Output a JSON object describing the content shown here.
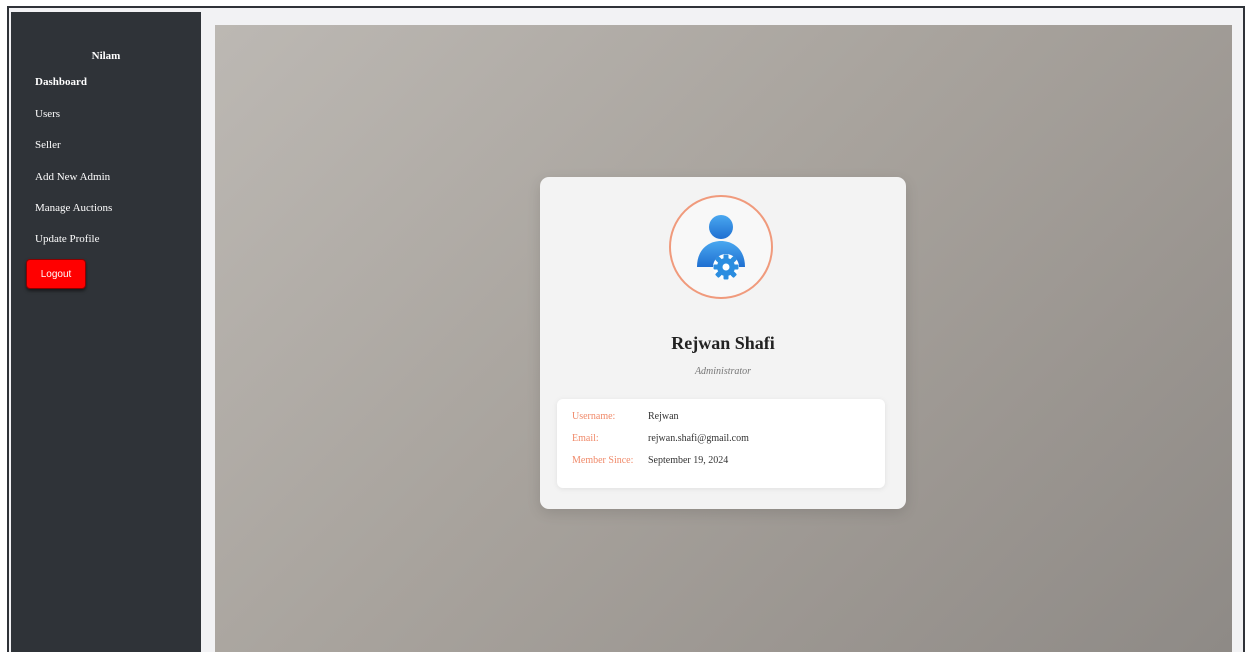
{
  "sidebar": {
    "brand": "Nilam",
    "items": [
      {
        "label": "Dashboard"
      },
      {
        "label": "Users"
      },
      {
        "label": "Seller"
      },
      {
        "label": "Add New Admin"
      },
      {
        "label": "Manage Auctions"
      },
      {
        "label": "Update Profile"
      }
    ],
    "logout_label": "Logout"
  },
  "profile": {
    "avatar_icon": "user-gear-icon",
    "name": "Rejwan Shafi",
    "role": "Administrator",
    "fields": [
      {
        "label": "Username:",
        "value": "Rejwan"
      },
      {
        "label": "Email:",
        "value": "rejwan.shafi@gmail.com"
      },
      {
        "label": "Member Since:",
        "value": "September 19, 2024"
      }
    ]
  },
  "colors": {
    "sidebar_bg": "#2f3338",
    "logout_bg": "#ff0000",
    "accent": "#f09a7c",
    "avatar_blue": "#2b8de0"
  }
}
